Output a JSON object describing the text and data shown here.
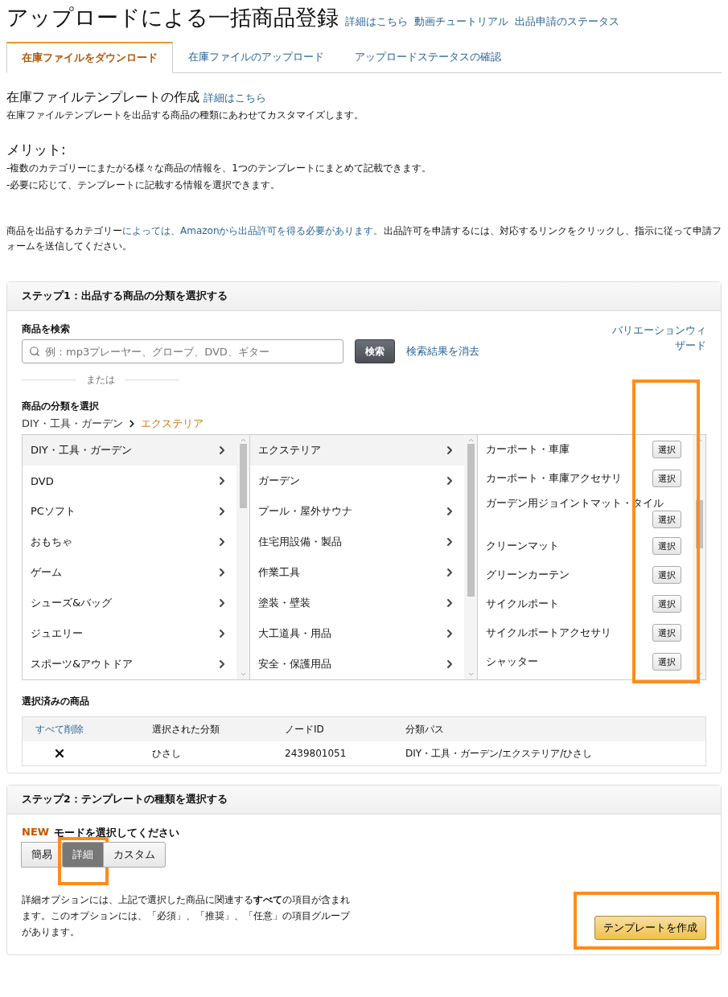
{
  "header": {
    "title": "アップロードによる一括商品登録",
    "links": [
      "詳細はこちら",
      "動画チュートリアル",
      "出品申請のステータス"
    ]
  },
  "tabs": [
    {
      "label": "在庫ファイルをダウンロード",
      "selected": true
    },
    {
      "label": "在庫ファイルのアップロード",
      "selected": false
    },
    {
      "label": "アップロードステータスの確認",
      "selected": false
    }
  ],
  "intro": {
    "title": "在庫ファイルテンプレートの作成",
    "title_link": "詳細はこちら",
    "description": "在庫ファイルテンプレートを出品する商品の種類にあわせてカスタマイズします。",
    "merit_title": "メリット:",
    "merits": [
      "-複数のカテゴリーにまたがる様々な商品の情報を、1つのテンプレートにまとめて記載できます。",
      "-必要に応じて、テンプレートに記載する情報を選択できます。"
    ],
    "notice_before": "商品を出品するカテゴリー",
    "notice_link": "によっては、Amazonから出品許可を得る必要があります。",
    "notice_after": "出品許可を申請するには、対応するリンクをクリックし、指示に従って申請フォームを送信してください。"
  },
  "step1": {
    "title": "ステップ1：出品する商品の分類を選択する",
    "search_label": "商品を検索",
    "search_placeholder": "例：mp3プレーヤー、グローブ、DVD、ギター",
    "search_button": "検索",
    "clear_link": "検索結果を消去",
    "variation_link": "バリエーションウィザード",
    "or": "または",
    "browse_label": "商品の分類を選択",
    "breadcrumb": [
      {
        "label": "DIY・工具・ガーデン",
        "selected": false
      },
      {
        "label": "エクステリア",
        "selected": true
      }
    ],
    "columns": [
      {
        "items": [
          {
            "label": "DIY・工具・ガーデン",
            "selected": true
          },
          {
            "label": "DVD",
            "selected": false
          },
          {
            "label": "PCソフト",
            "selected": false
          },
          {
            "label": "おもちゃ",
            "selected": false
          },
          {
            "label": "ゲーム",
            "selected": false
          },
          {
            "label": "シューズ&バッグ",
            "selected": false
          },
          {
            "label": "ジュエリー",
            "selected": false
          },
          {
            "label": "スポーツ&アウトドア",
            "selected": false
          }
        ]
      },
      {
        "items": [
          {
            "label": "エクステリア",
            "selected": true
          },
          {
            "label": "ガーデン",
            "selected": false
          },
          {
            "label": "プール・屋外サウナ",
            "selected": false
          },
          {
            "label": "住宅用設備・製品",
            "selected": false
          },
          {
            "label": "作業工具",
            "selected": false
          },
          {
            "label": "塗装・壁装",
            "selected": false
          },
          {
            "label": "大工道具・用品",
            "selected": false
          },
          {
            "label": "安全・保護用品",
            "selected": false
          }
        ]
      }
    ],
    "leaves": [
      {
        "label": "カーポート・車庫",
        "button": "選択"
      },
      {
        "label": "カーポート・車庫アクセサリ",
        "button": "選択"
      },
      {
        "label": "ガーデン用ジョイントマット・タイル",
        "button": "選択"
      },
      {
        "label": "クリーンマット",
        "button": "選択"
      },
      {
        "label": "グリーンカーテン",
        "button": "選択"
      },
      {
        "label": "サイクルポート",
        "button": "選択"
      },
      {
        "label": "サイクルポートアクセサリ",
        "button": "選択"
      },
      {
        "label": "シャッター",
        "button": "選択"
      }
    ],
    "selected_title": "選択済みの商品",
    "table": {
      "delete_all": "すべて削除",
      "columns": [
        "選択された分類",
        "ノードID",
        "分類パス"
      ],
      "rows": [
        {
          "category": "ひさし",
          "node_id": "2439801051",
          "path": "DIY・工具・ガーデン/エクステリア/ひさし"
        }
      ]
    }
  },
  "step2": {
    "title": "ステップ2：テンプレートの種類を選択する",
    "badge": "NEW",
    "mode_label": "モードを選択してください",
    "modes": [
      {
        "label": "簡易",
        "selected": false
      },
      {
        "label": "詳細",
        "selected": true
      },
      {
        "label": "カスタム",
        "selected": false
      }
    ],
    "description": "詳細オプションには、上記で選択した商品に関連する**すべて**の項目が含まれます。このオプションには、「必須」、「推奨」、「任意」の項目グループがあります。",
    "create_button": "テンプレートを作成"
  }
}
